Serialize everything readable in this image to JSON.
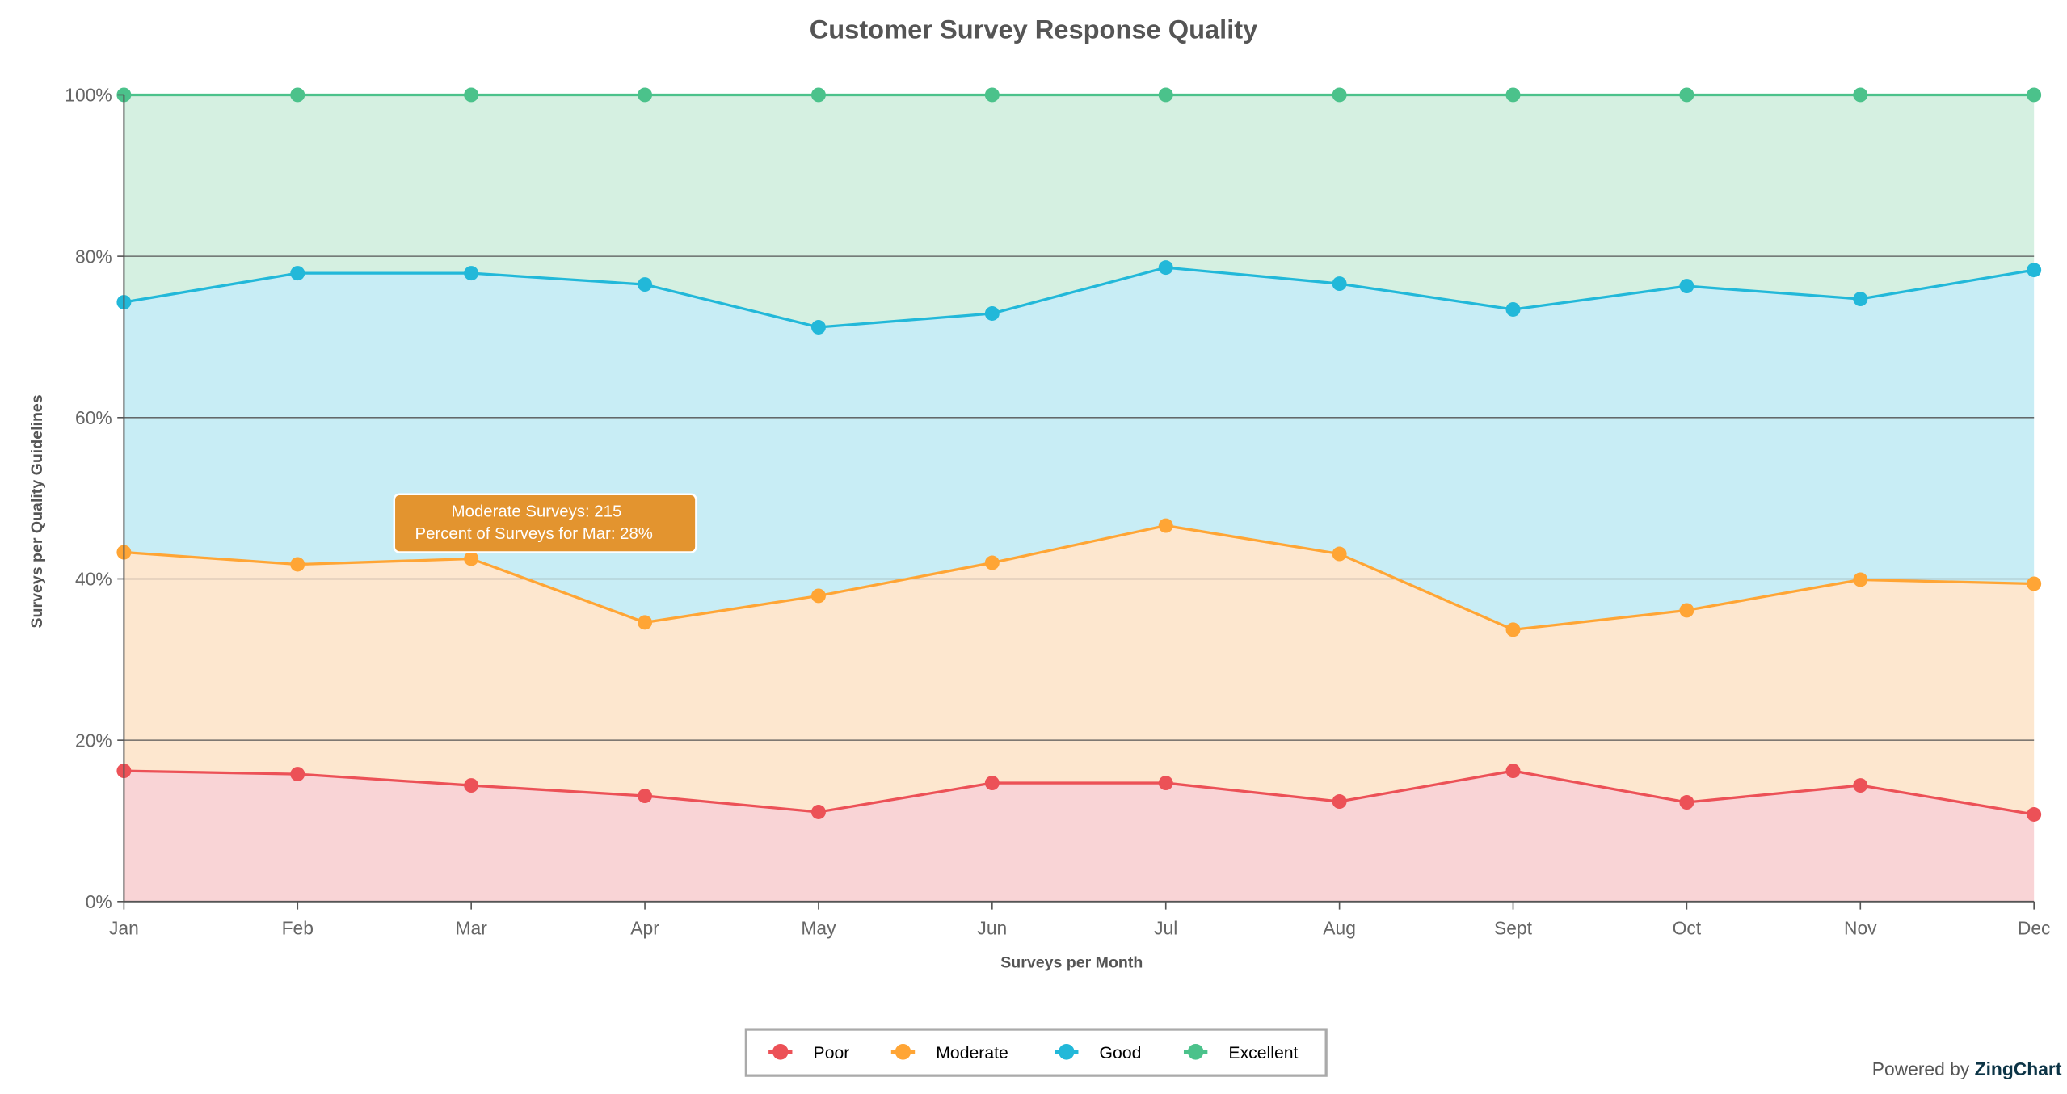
{
  "chart_data": {
    "type": "area",
    "stacked": true,
    "stack_mode": "100%",
    "title": "Customer Survey Response Quality",
    "xlabel": "Surveys per Month",
    "ylabel": "Surveys per Quality Guidelines",
    "categories": [
      "Jan",
      "Feb",
      "Mar",
      "Apr",
      "May",
      "Jun",
      "Jul",
      "Aug",
      "Sept",
      "Oct",
      "Nov",
      "Dec"
    ],
    "y_ticks": [
      "0%",
      "20%",
      "40%",
      "60%",
      "80%",
      "100%"
    ],
    "ylim": [
      0,
      100
    ],
    "grid": true,
    "legend_position": "bottom",
    "series": [
      {
        "name": "Poor",
        "color": "#ec5157",
        "fill": "#f9d4d6",
        "values": [
          16.2,
          15.8,
          14.4,
          13.1,
          11.1,
          14.7,
          14.7,
          12.4,
          16.2,
          12.3,
          14.4,
          10.8
        ]
      },
      {
        "name": "Moderate",
        "color": "#ffa535",
        "fill": "#fde7cf",
        "values": [
          27.1,
          26.0,
          28.1,
          21.5,
          26.8,
          27.3,
          31.9,
          30.7,
          17.5,
          23.8,
          25.5,
          28.6
        ]
      },
      {
        "name": "Good",
        "color": "#22b8d9",
        "fill": "#c8edf5",
        "values": [
          31.0,
          36.1,
          35.4,
          41.9,
          33.3,
          30.9,
          32.0,
          33.5,
          39.7,
          40.2,
          34.8,
          38.9
        ]
      },
      {
        "name": "Excellent",
        "color": "#4bc28b",
        "fill": "#d5f0e1",
        "values": [
          25.7,
          22.1,
          22.1,
          23.5,
          28.8,
          27.1,
          21.4,
          23.4,
          26.6,
          23.7,
          25.3,
          21.7
        ]
      }
    ],
    "tooltip": {
      "line1": "Moderate Surveys: 215",
      "line2": "Percent of Surveys for Mar: 28%",
      "color": "#e3942f"
    }
  },
  "credit": {
    "prefix": "Powered by ",
    "brand": "ZingChart"
  }
}
